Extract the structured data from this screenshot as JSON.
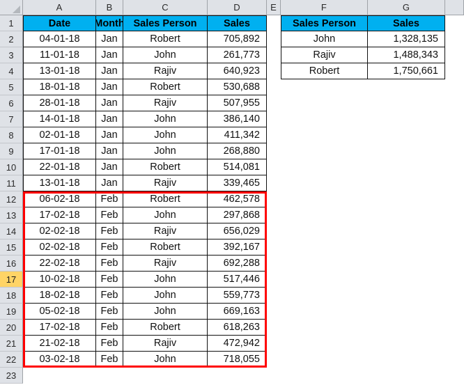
{
  "spreadsheet": {
    "column_headers": [
      "A",
      "B",
      "C",
      "D",
      "E",
      "F",
      "G"
    ],
    "row_numbers": [
      "1",
      "2",
      "3",
      "4",
      "5",
      "6",
      "7",
      "8",
      "9",
      "10",
      "11",
      "12",
      "13",
      "14",
      "15",
      "16",
      "17",
      "18",
      "19",
      "20",
      "21",
      "22",
      "23"
    ],
    "selected_row": "17",
    "select_all_icon": "select-all-triangle-icon"
  },
  "colors": {
    "header_fill": "#00B0F0",
    "highlight_border": "#FF0000",
    "selected_row_header": "#FFD466",
    "row_header_fill": "#DFE2E7",
    "grid_line": "#111111"
  },
  "main_table": {
    "headers": [
      "Date",
      "Month",
      "Sales Person",
      "Sales"
    ],
    "rows": [
      [
        "04-01-18",
        "Jan",
        "Robert",
        "705,892"
      ],
      [
        "11-01-18",
        "Jan",
        "John",
        "261,773"
      ],
      [
        "13-01-18",
        "Jan",
        "Rajiv",
        "640,923"
      ],
      [
        "18-01-18",
        "Jan",
        "Robert",
        "530,688"
      ],
      [
        "28-01-18",
        "Jan",
        "Rajiv",
        "507,955"
      ],
      [
        "14-01-18",
        "Jan",
        "John",
        "386,140"
      ],
      [
        "02-01-18",
        "Jan",
        "John",
        "411,342"
      ],
      [
        "17-01-18",
        "Jan",
        "John",
        "268,880"
      ],
      [
        "22-01-18",
        "Jan",
        "Robert",
        "514,081"
      ],
      [
        "13-01-18",
        "Jan",
        "Rajiv",
        "339,465"
      ],
      [
        "06-02-18",
        "Feb",
        "Robert",
        "462,578"
      ],
      [
        "17-02-18",
        "Feb",
        "John",
        "297,868"
      ],
      [
        "02-02-18",
        "Feb",
        "Rajiv",
        "656,029"
      ],
      [
        "02-02-18",
        "Feb",
        "Robert",
        "392,167"
      ],
      [
        "22-02-18",
        "Feb",
        "Rajiv",
        "692,288"
      ],
      [
        "10-02-18",
        "Feb",
        "John",
        "517,446"
      ],
      [
        "18-02-18",
        "Feb",
        "John",
        "559,773"
      ],
      [
        "05-02-18",
        "Feb",
        "John",
        "669,163"
      ],
      [
        "17-02-18",
        "Feb",
        "Robert",
        "618,263"
      ],
      [
        "21-02-18",
        "Feb",
        "Rajiv",
        "472,942"
      ],
      [
        "03-02-18",
        "Feb",
        "John",
        "718,055"
      ]
    ]
  },
  "summary_table": {
    "headers": [
      "Sales Person",
      "Sales"
    ],
    "rows": [
      [
        "John",
        "1,328,135"
      ],
      [
        "Rajiv",
        "1,488,343"
      ],
      [
        "Robert",
        "1,750,661"
      ]
    ]
  }
}
